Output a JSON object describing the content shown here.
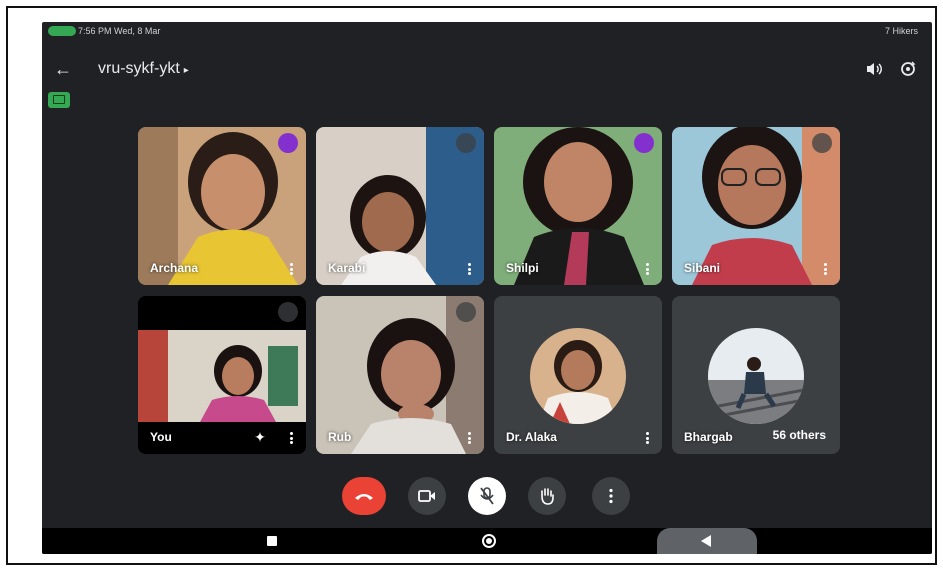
{
  "status_bar": {
    "left": "7:56 PM Wed, 8 Mar",
    "right": "7 Hikers"
  },
  "header": {
    "meeting_code": "vru-sykf-ykt",
    "caret": "▸"
  },
  "tiles": [
    {
      "name": "Archana",
      "state": "speaking"
    },
    {
      "name": "Karabi",
      "state": "muted"
    },
    {
      "name": "Shilpi",
      "state": "speaking"
    },
    {
      "name": "Sibani",
      "state": "muted"
    },
    {
      "name": "You",
      "state": "muted"
    },
    {
      "name": "Rub",
      "state": "muted"
    },
    {
      "name": "Dr. Alaka",
      "state": "muted"
    },
    {
      "name": "Bhargab",
      "state": "muted"
    }
  ],
  "others_count_label": "56 others",
  "colors": {
    "background": "#202124",
    "tile": "#3c4043",
    "speaking": "#8430ce",
    "end_call": "#ea4335",
    "accent_green": "#34a853"
  },
  "icons": [
    "back-arrow-icon",
    "speaker-icon",
    "flip-camera-icon",
    "captions-icon",
    "end-call-icon",
    "camera-icon",
    "mic-off-icon",
    "raise-hand-icon",
    "more-options-icon"
  ]
}
